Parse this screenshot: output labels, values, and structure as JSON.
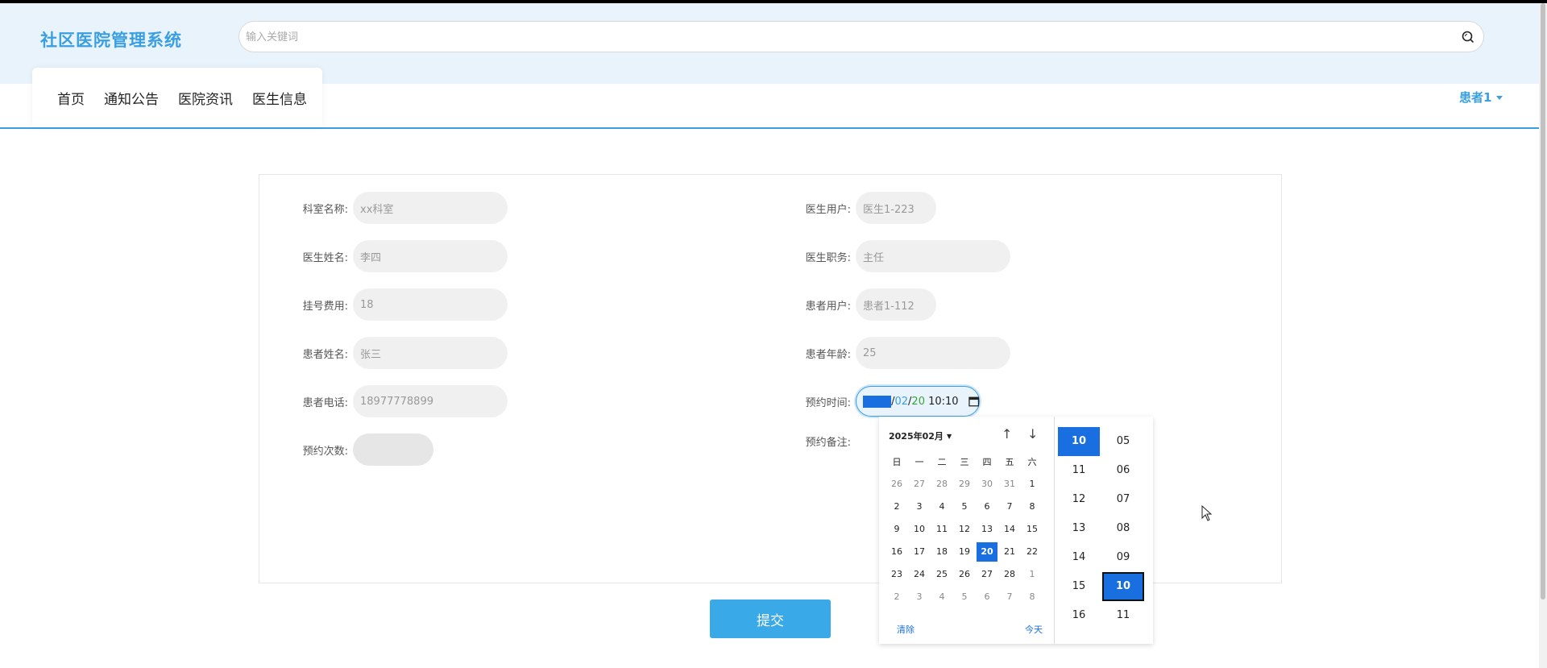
{
  "app": {
    "title": "社区医院管理系统"
  },
  "search": {
    "placeholder": "输入关键词"
  },
  "nav": {
    "items": [
      "首页",
      "通知公告",
      "医院资讯",
      "医生信息"
    ]
  },
  "user": {
    "name": "患者1"
  },
  "form": {
    "left": [
      {
        "label": "科室名称:",
        "value": "xx科室"
      },
      {
        "label": "医生姓名:",
        "value": "李四"
      },
      {
        "label": "挂号费用:",
        "value": "18"
      },
      {
        "label": "患者姓名:",
        "value": "张三"
      },
      {
        "label": "患者电话:",
        "value": "18977778899"
      },
      {
        "label": "预约次数:",
        "value": ""
      }
    ],
    "right": [
      {
        "label": "医生用户:",
        "value": "医生1-223"
      },
      {
        "label": "医生职务:",
        "value": "主任"
      },
      {
        "label": "患者用户:",
        "value": "患者1-112"
      },
      {
        "label": "患者年龄:",
        "value": "25"
      },
      {
        "label": "预约时间:",
        "value": ""
      },
      {
        "label": "预约备注:",
        "value": ""
      }
    ],
    "datetime": {
      "year": "2025",
      "month": "02",
      "day": "20",
      "sep": "/",
      "time": "10:10"
    },
    "submit_label": "提交"
  },
  "picker": {
    "title": "2025年02月",
    "weekdays": [
      "日",
      "一",
      "二",
      "三",
      "四",
      "五",
      "六"
    ],
    "days": [
      [
        "26",
        "27",
        "28",
        "29",
        "30",
        "31",
        "1"
      ],
      [
        "2",
        "3",
        "4",
        "5",
        "6",
        "7",
        "8"
      ],
      [
        "9",
        "10",
        "11",
        "12",
        "13",
        "14",
        "15"
      ],
      [
        "16",
        "17",
        "18",
        "19",
        "20",
        "21",
        "22"
      ],
      [
        "23",
        "24",
        "25",
        "26",
        "27",
        "28",
        "1"
      ],
      [
        "2",
        "3",
        "4",
        "5",
        "6",
        "7",
        "8"
      ]
    ],
    "selected_day": "20",
    "clear_label": "清除",
    "today_label": "今天",
    "hours": [
      "10",
      "11",
      "12",
      "13",
      "14",
      "15",
      "16"
    ],
    "minutes": [
      "05",
      "06",
      "07",
      "08",
      "09",
      "10",
      "11"
    ],
    "selected_hour": "10",
    "selected_minute": "10"
  },
  "colors": {
    "accent": "#3a9fe0",
    "selected": "#1a6fe0",
    "header_bg": "#e9f3fb",
    "submit": "#3aa9e8"
  }
}
